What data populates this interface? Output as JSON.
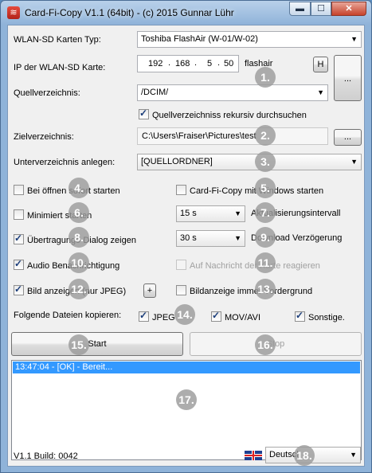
{
  "window": {
    "title": "Card-Fi-Copy V1.1 (64bit) - (c) 2015 Gunnar Lühr",
    "min_label": "▬",
    "max_label": "☐",
    "close_label": "✕"
  },
  "card_type": {
    "label": "WLAN-SD Karten Typ:",
    "value": "Toshiba FlashAir (W-01/W-02)"
  },
  "ip": {
    "label": "IP der WLAN-SD Karte:",
    "octets": [
      "192",
      "168",
      "5",
      "50"
    ],
    "suffix": "flashair",
    "h_button": "H"
  },
  "source": {
    "label": "Quellverzeichnis:",
    "value": "/DCIM/",
    "browse": "...",
    "recursive_label": "Quellverzeichniss rekursiv durchsuchen",
    "recursive_checked": true
  },
  "target": {
    "label": "Zielverzeichnis:",
    "value": "C:\\Users\\Fraiser\\Pictures\\test",
    "browse": "..."
  },
  "subdir": {
    "label": "Unterverzeichnis anlegen:",
    "value": "[QUELLORDNER]"
  },
  "options": {
    "start_on_open": {
      "label": "Bei öffnen sofort starten",
      "checked": false
    },
    "start_minimized": {
      "label": "Minimiert starten",
      "checked": false
    },
    "show_transfer_dialog": {
      "label": "Übertragungs-Dialog zeigen",
      "checked": true
    },
    "audio_notify": {
      "label": "Audio Benachrichtigung",
      "checked": true
    },
    "show_image": {
      "label": "Bild anzeigen (nur JPEG)",
      "checked": true,
      "plus": "+"
    },
    "start_with_windows": {
      "label": "Card-Fi-Copy mit Windows starten",
      "checked": false
    },
    "refresh_interval": {
      "value": "15 s",
      "label": "Aktualisierungsintervall"
    },
    "download_delay": {
      "value": "30 s",
      "label": "Download Verzögerung"
    },
    "react_card_message": {
      "label": "Auf Nachricht der Karte reagieren",
      "checked": false
    },
    "image_foreground": {
      "label": "Bildanzeige immer Vordergrund",
      "checked": false
    }
  },
  "filetypes": {
    "label": "Folgende Dateien kopieren:",
    "jpeg": {
      "label": "JPEG",
      "checked": true
    },
    "mov": {
      "label": "MOV/AVI",
      "checked": true
    },
    "other": {
      "label": "Sonstige.",
      "checked": true
    }
  },
  "actions": {
    "start": "Start",
    "stop": "Stop"
  },
  "log": {
    "lines": [
      "13:47:04 - [OK] - Bereit..."
    ]
  },
  "footer": {
    "build": "V1.1 Build: 0042",
    "language": "Deutsch"
  },
  "markers": [
    "1.",
    "2.",
    "3.",
    "4.",
    "5.",
    "6.",
    "7.",
    "8.",
    "9.",
    "10.",
    "11.",
    "12.",
    "13.",
    "14.",
    "15.",
    "16.",
    "17.",
    "18."
  ]
}
